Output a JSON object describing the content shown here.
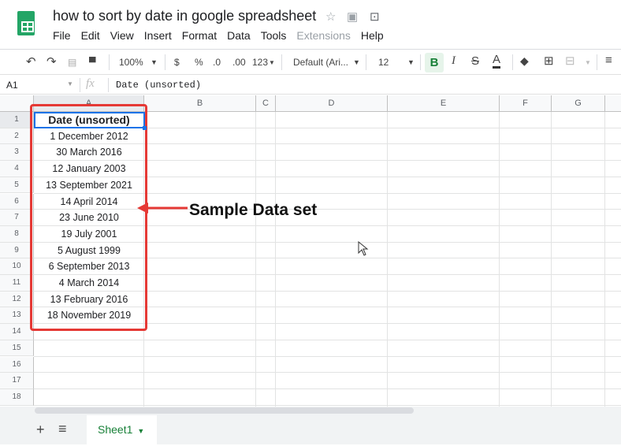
{
  "app": {
    "title": "how to sort by date in google spreadsheet",
    "brand_color": "#23a566"
  },
  "menu": [
    "File",
    "Edit",
    "View",
    "Insert",
    "Format",
    "Data",
    "Tools",
    "Extensions",
    "Help"
  ],
  "toolbar": {
    "zoom": "100%",
    "currency": "$",
    "percent": "%",
    "dec_less": ".0",
    "dec_more": ".00",
    "format": "123",
    "font": "Default (Ari...",
    "size": "12",
    "bold": "B",
    "italic": "I",
    "strike": "S",
    "color": "A"
  },
  "formula_bar": {
    "cell_ref": "A1",
    "fx": "fx",
    "content": "Date (unsorted)"
  },
  "columns": [
    "A",
    "B",
    "C",
    "D",
    "E",
    "F",
    "G"
  ],
  "rows": [
    "1",
    "2",
    "3",
    "4",
    "5",
    "6",
    "7",
    "8",
    "9",
    "10",
    "11",
    "12",
    "13",
    "14",
    "15",
    "16",
    "17",
    "18"
  ],
  "cells": [
    "Date (unsorted)",
    "1 December 2012",
    "30 March 2016",
    "12 January 2003",
    "13 September 2021",
    "14 April 2014",
    "23 June 2010",
    "19 July 2001",
    "5 August 1999",
    "6 September 2013",
    "4 March 2014",
    "13 February 2016",
    "18 November 2019"
  ],
  "annotation": {
    "label": "Sample Data set",
    "color": "#e53935"
  },
  "sheets": {
    "add": "+",
    "list": "≡",
    "active": "Sheet1"
  }
}
